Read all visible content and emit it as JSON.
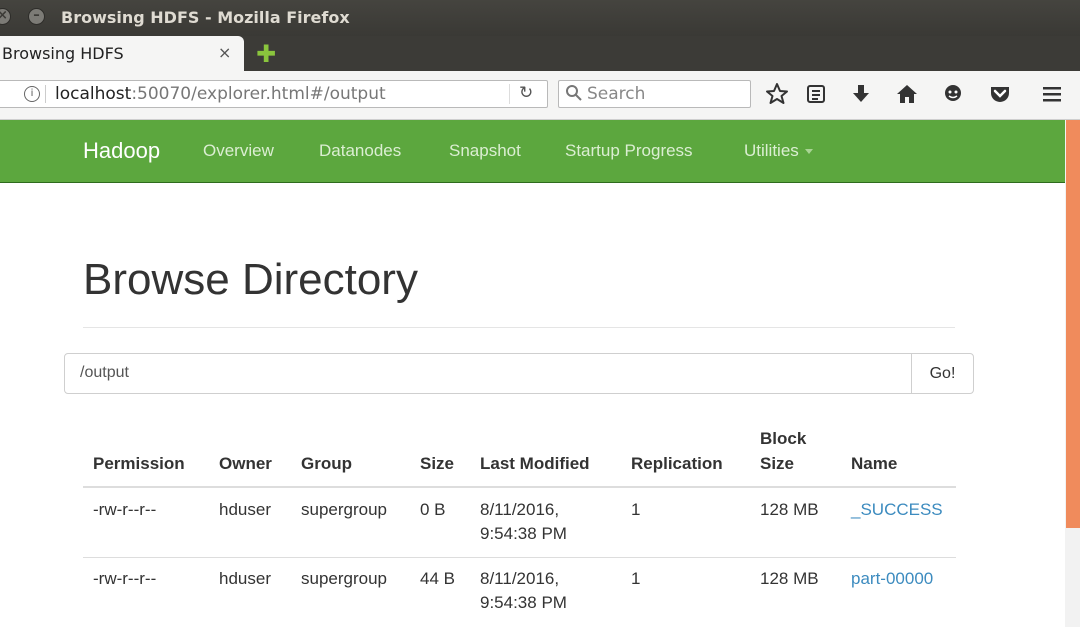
{
  "window": {
    "title": "Browsing HDFS - Mozilla Firefox"
  },
  "tabs": [
    {
      "label": "Browsing HDFS",
      "close": "×"
    }
  ],
  "browser": {
    "url_host": "localhost",
    "url_rest": ":50070/explorer.html#/output",
    "search_placeholder": "Search",
    "toolbar_icons": [
      "bookmark-star-icon",
      "reading-list-icon",
      "download-icon",
      "home-icon",
      "chat-icon",
      "pocket-icon",
      "menu-icon"
    ]
  },
  "hadoop_nav": {
    "brand": "Hadoop",
    "items": [
      "Overview",
      "Datanodes",
      "Snapshot",
      "Startup Progress",
      "Utilities"
    ]
  },
  "page": {
    "title": "Browse Directory",
    "path_value": "/output",
    "go_label": "Go!"
  },
  "table": {
    "headers": {
      "permission": "Permission",
      "owner": "Owner",
      "group": "Group",
      "size": "Size",
      "last_modified": "Last Modified",
      "replication": "Replication",
      "block_size_1": "Block",
      "block_size_2": "Size",
      "name": "Name"
    },
    "rows": [
      {
        "permission": "-rw-r--r--",
        "owner": "hduser",
        "group": "supergroup",
        "size": "0 B",
        "modified_date": "8/11/2016,",
        "modified_time": "9:54:38 PM",
        "replication": "1",
        "block_size": "128 MB",
        "name": "_SUCCESS"
      },
      {
        "permission": "-rw-r--r--",
        "owner": "hduser",
        "group": "supergroup",
        "size": "44 B",
        "modified_date": "8/11/2016,",
        "modified_time": "9:54:38 PM",
        "replication": "1",
        "block_size": "128 MB",
        "name": "part-00000"
      }
    ]
  },
  "colors": {
    "hadoop_green": "#5ca73e",
    "link_blue": "#3c8bbf",
    "scroll_accent": "#f08b5c"
  }
}
